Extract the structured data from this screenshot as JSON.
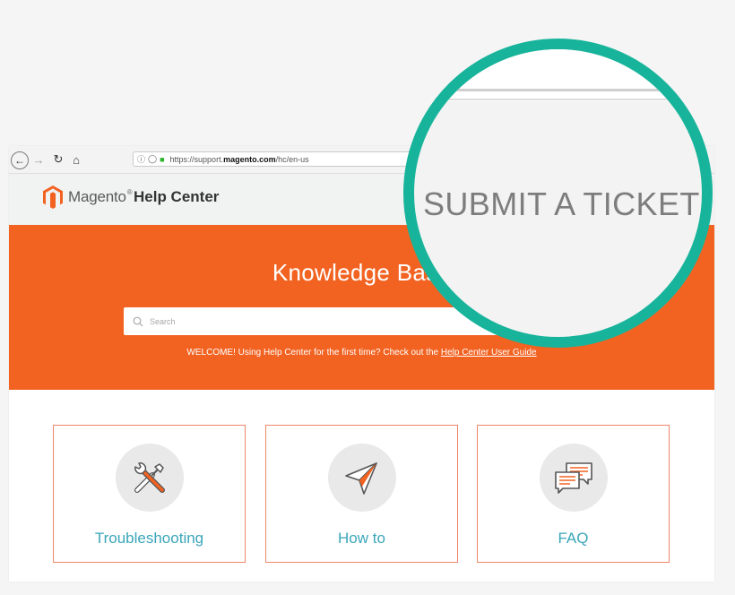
{
  "browser": {
    "url_prefix": "https://support.",
    "url_host": "magento.com",
    "url_path": "/hc/en-us",
    "icons": [
      "back-icon",
      "forward-icon",
      "reload-icon",
      "home-icon",
      "info-icon",
      "shield-icon",
      "lock-icon"
    ]
  },
  "header": {
    "brand": "Magento",
    "trademark": "®",
    "product": "Help Center"
  },
  "hero": {
    "title": "Knowledge Base",
    "search_placeholder": "Search",
    "welcome_text": "WELCOME! Using Help Center for the first time? Check out the ",
    "welcome_link": "Help Center User Guide"
  },
  "categories": [
    {
      "label": "Troubleshooting",
      "icon": "tools-icon"
    },
    {
      "label": "How to",
      "icon": "paper-plane-icon"
    },
    {
      "label": "FAQ",
      "icon": "chat-bubbles-icon"
    }
  ],
  "magnifier": {
    "text": "SUBMIT A TICKET"
  },
  "colors": {
    "accent": "#f26322",
    "teal": "#3aa6b9",
    "lens_border": "#17b49b",
    "card_border": "#f0866a"
  }
}
